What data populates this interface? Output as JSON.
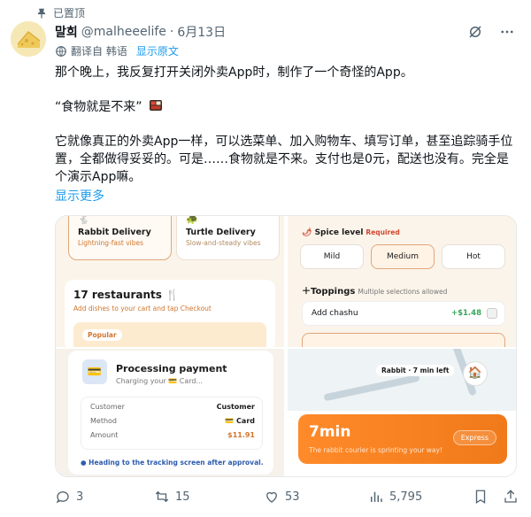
{
  "pinned": {
    "label": "已置顶",
    "icon": "pin-icon"
  },
  "author": {
    "name": "말희",
    "handle": "@malheeelife",
    "separator": "·",
    "date": "6月13日"
  },
  "translation": {
    "label": "翻译自 韩语",
    "show_original": "显示原文",
    "icon": "translate-icon"
  },
  "post": {
    "line1": "那个晚上，我反复打开关闭外卖App时，制作了一个奇怪的App。",
    "line2": "“食物就是不来”",
    "line3": "它就像真正的外卖App一样，可以选菜单、加入购物车、填写订单，甚至追踪骑手位置，全都做得妥妥的。可是……食物就是不来。支付也是0元，配送也没有。完全是个演示App嘛。",
    "show_more": "显示更多"
  },
  "media": {
    "panel1": {
      "delivery_options": [
        {
          "title": "Rabbit Delivery",
          "sub": "Lightning-fast vibes"
        },
        {
          "title": "Turtle Delivery",
          "sub": "Slow-and-steady vibes"
        }
      ],
      "restaurants_title": "17 restaurants",
      "restaurants_sub": "Add dishes to your cart and tap Checkout",
      "popular": "Popular"
    },
    "panel2": {
      "spice_label": "Spice level",
      "required": "Required",
      "options": [
        "Mild",
        "Medium",
        "Hot"
      ],
      "selected": "Medium",
      "toppings_label": "Toppings",
      "toppings_note": "Multiple selections allowed",
      "topping_item": "Add chashu",
      "topping_price": "+$1.48"
    },
    "panel3": {
      "title": "Processing payment",
      "sub": "Charging your 💳 Card...",
      "rows": [
        {
          "label": "Customer",
          "value": "Customer"
        },
        {
          "label": "Method",
          "value": "💳 Card"
        },
        {
          "label": "Amount",
          "value": "$11.91"
        }
      ],
      "note": "Heading to the tracking screen after approval."
    },
    "panel4": {
      "rabbit_status": "Rabbit · 7 min left",
      "eta": "7min",
      "eta_sub": "The rabbit courier is sprinting your way!",
      "express": "Express"
    }
  },
  "actions": {
    "replies": "3",
    "reposts": "15",
    "likes": "53",
    "views": "5,795"
  }
}
